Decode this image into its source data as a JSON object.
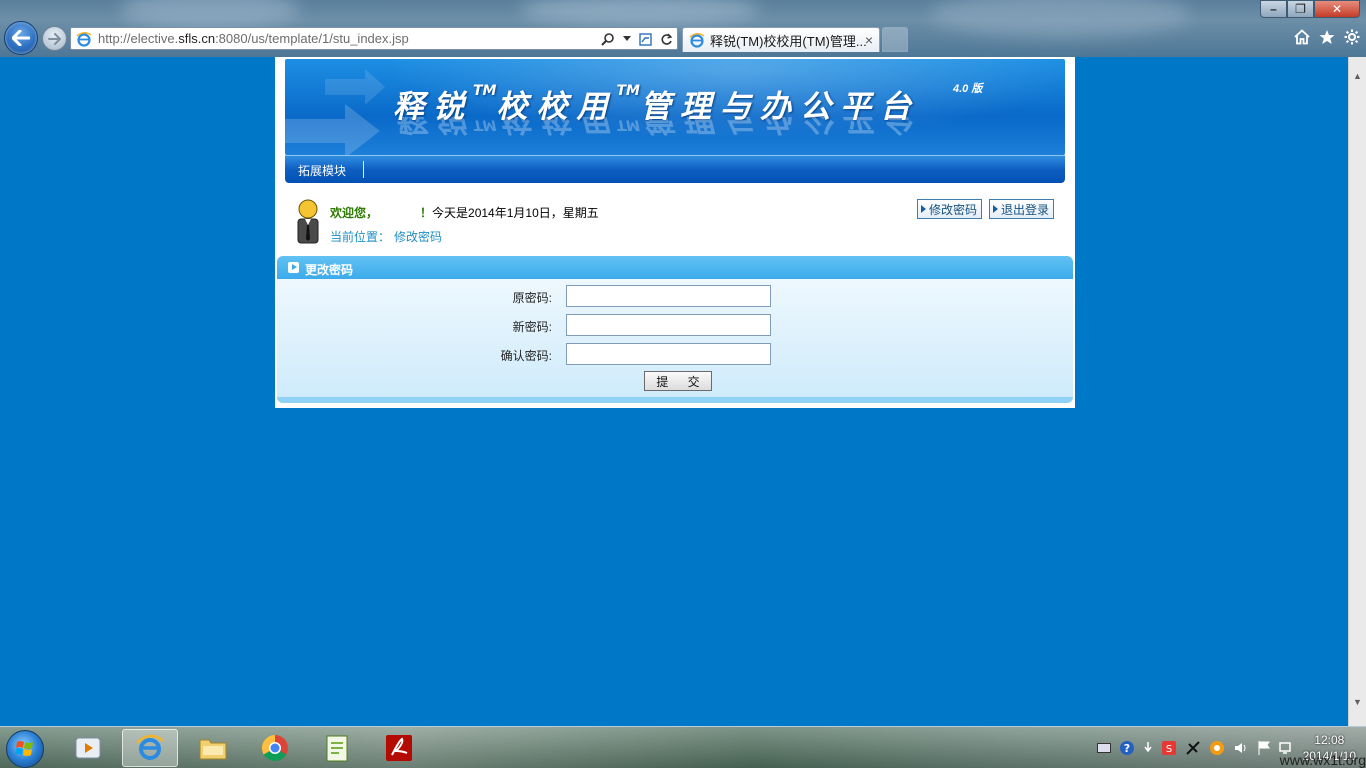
{
  "browser": {
    "url_prefix": "http://elective.",
    "url_domain": "sfls.cn",
    "url_suffix": ":8080/us/template/1/stu_index.jsp",
    "tab_title": "释锐(TM)校校用(TM)管理...",
    "tab_close": "×",
    "window_controls": {
      "minimize": "–",
      "maximize": "❐",
      "close": "✕"
    }
  },
  "banner": {
    "logo_part1": "释锐",
    "tm1": "TM",
    "logo_part2": "校校用",
    "tm2": "TM",
    "logo_part3": "管理与办公平台",
    "version": "4.0 版"
  },
  "menu": {
    "items": [
      {
        "label": "拓展模块"
      }
    ]
  },
  "welcome": {
    "greeting": "欢迎您，",
    "exclamation": "！",
    "date_text": "今天是2014年1月10日，星期五",
    "location_label": "当前位置：",
    "location_value": "修改密码"
  },
  "actions": {
    "change_password": "修改密码",
    "logout": "退出登录"
  },
  "panel": {
    "title": "更改密码",
    "fields": [
      {
        "label": "原密码:",
        "value": ""
      },
      {
        "label": "新密码:",
        "value": ""
      },
      {
        "label": "确认密码:",
        "value": ""
      }
    ],
    "submit": "提 交"
  },
  "taskbar": {
    "time": "12:08",
    "date": "2014/1/10",
    "watermark": "www.wx1t.org"
  },
  "colors": {
    "page_bg": "#0078c8",
    "banner_blue": "#0a69c9",
    "panel_head": "#3cabeb",
    "welcome_green": "#2f7a00"
  }
}
